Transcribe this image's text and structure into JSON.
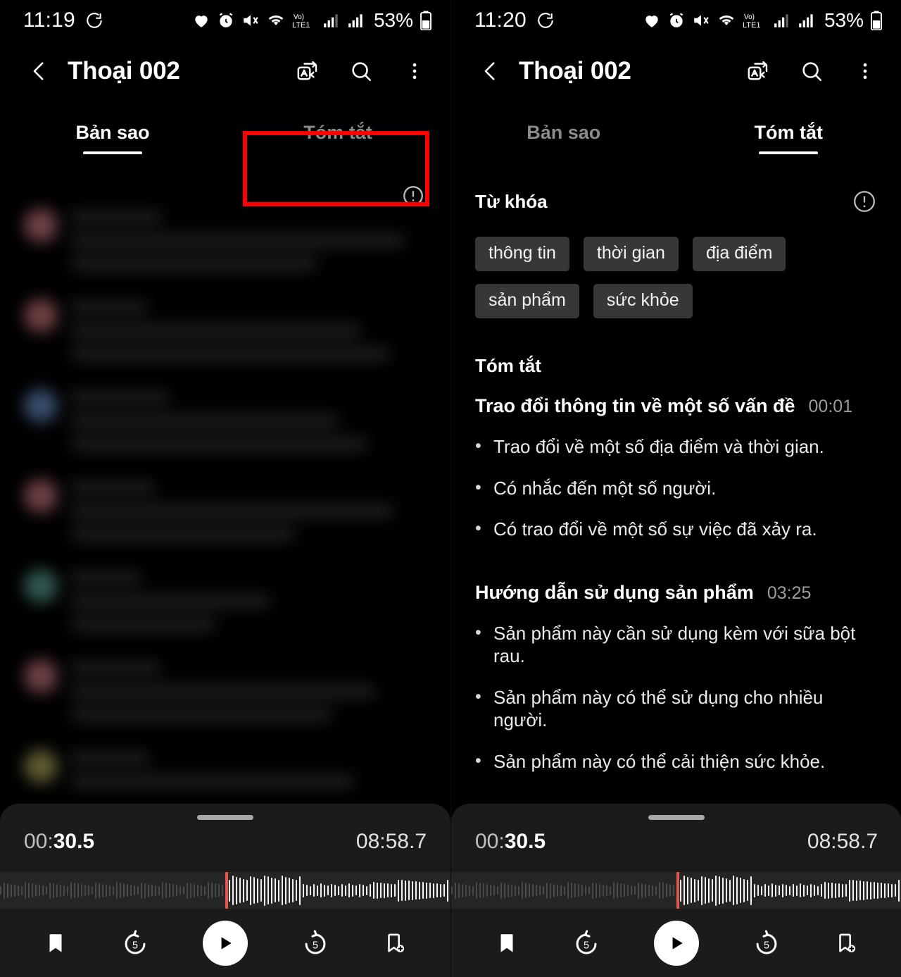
{
  "panels": [
    {
      "id": "left",
      "status": {
        "time": "11:19",
        "battery": "53%"
      },
      "appbar": {
        "title": "Thoại 002",
        "back_icon": "back-arrow-icon",
        "translate_icon": "translate-icon",
        "search_icon": "search-icon",
        "more_icon": "more-options-icon"
      },
      "tabs": [
        {
          "label": "Bản sao",
          "active": true
        },
        {
          "label": "Tóm tắt",
          "active": false
        }
      ],
      "highlight": {
        "color": "#ff0000",
        "target": "Tóm tắt"
      },
      "info_icon": "info-circle-icon",
      "content_state": "blurred-transcript",
      "player": {
        "current_time_prefix": "00:",
        "current_time_value": "30.5",
        "total_time": "08:58.7",
        "bookmark_icon": "bookmark-icon",
        "rewind_label": "5",
        "forward_label": "5",
        "play_icon": "play-icon",
        "add_bookmark_icon": "add-bookmark-icon",
        "playhead_percent": 50
      }
    },
    {
      "id": "right",
      "status": {
        "time": "11:20",
        "battery": "53%"
      },
      "appbar": {
        "title": "Thoại 002",
        "back_icon": "back-arrow-icon",
        "translate_icon": "translate-icon",
        "search_icon": "search-icon",
        "more_icon": "more-options-icon"
      },
      "tabs": [
        {
          "label": "Bản sao",
          "active": false
        },
        {
          "label": "Tóm tắt",
          "active": true
        }
      ],
      "summary": {
        "keywords_label": "Từ khóa",
        "info_icon": "info-circle-icon",
        "keywords": [
          "thông tin",
          "thời gian",
          "địa điểm",
          "sản phẩm",
          "sức khỏe"
        ],
        "summary_label": "Tóm tắt",
        "sections": [
          {
            "heading": "Trao đổi thông tin về một số vấn đề",
            "timestamp": "00:01",
            "bullets": [
              "Trao đổi về một số địa điểm và thời gian.",
              "Có nhắc đến một số người.",
              "Có trao đổi về một số sự việc đã xảy ra."
            ]
          },
          {
            "heading": "Hướng dẫn sử dụng sản phẩm",
            "timestamp": "03:25",
            "bullets": [
              "Sản phẩm này cần sử dụng kèm với sữa bột rau.",
              "Sản phẩm này có thể sử dụng cho nhiều người.",
              "Sản phẩm này có thể cải thiện sức khỏe."
            ]
          }
        ]
      },
      "player": {
        "current_time_prefix": "00:",
        "current_time_value": "30.5",
        "total_time": "08:58.7",
        "bookmark_icon": "bookmark-icon",
        "rewind_label": "5",
        "forward_label": "5",
        "play_icon": "play-icon",
        "add_bookmark_icon": "add-bookmark-icon",
        "playhead_percent": 50
      }
    }
  ],
  "colors": {
    "background": "#000000",
    "chip_background": "#373737",
    "player_background": "#1b1b1b",
    "playhead": "#e2564f",
    "highlight": "#ff0000",
    "accent_text": "#ffffff"
  },
  "blurred_transcript_avatars": [
    "#b56c72",
    "#b5686e",
    "#5b7fae",
    "#b4696f",
    "#4e8f84",
    "#b26a70",
    "#9a9352"
  ]
}
